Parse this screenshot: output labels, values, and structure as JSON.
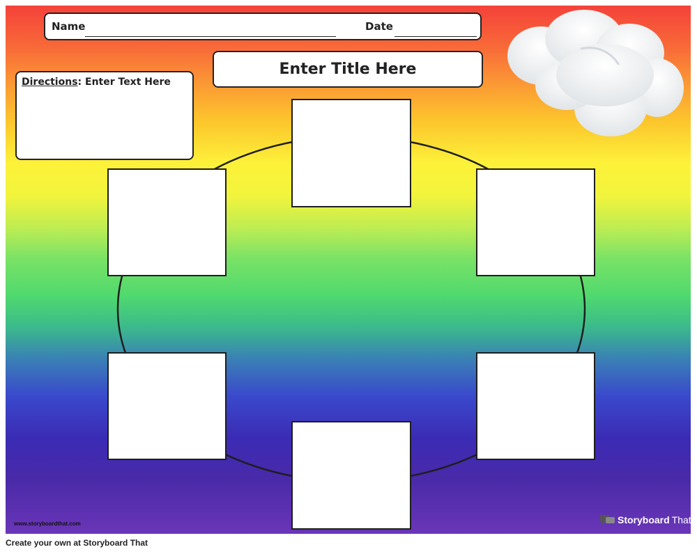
{
  "worksheet": {
    "name_label": "Name",
    "date_label": "Date",
    "title": "Enter Title Here",
    "directions_label": "Directions",
    "directions_text": ": Enter Text Here",
    "cycle_boxes": [
      "",
      "",
      "",
      "",
      "",
      ""
    ]
  },
  "watermark": {
    "url": "www.storyboardthat.com",
    "brand_main": "Storyboard",
    "brand_suffix": "That"
  },
  "footer": {
    "text": "Create your own at Storyboard That"
  },
  "colors": {
    "gradient": [
      "#f4423a",
      "#fb9a34",
      "#fdf23a",
      "#4fd96e",
      "#3a49cc",
      "#6a36b8"
    ],
    "box_border": "#1e1e1e",
    "cloud": "#f2f4f5"
  },
  "icons": {
    "cloud": "cloud-icon",
    "brand": "speech-bubble-logo-icon"
  }
}
